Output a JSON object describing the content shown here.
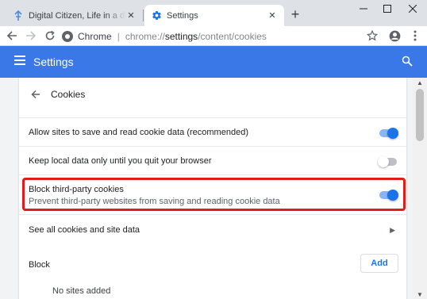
{
  "tabs": [
    {
      "title": "Digital Citizen, Life in a digital world",
      "favicon": "digital-citizen-icon",
      "active": false
    },
    {
      "title": "Settings",
      "favicon": "gear-icon",
      "active": true
    }
  ],
  "omnibox": {
    "chip": "Chrome",
    "separator": "|",
    "scheme": "chrome://",
    "host": "settings",
    "path": "/content/cookies"
  },
  "header": {
    "title": "Settings"
  },
  "subpage": {
    "title": "Cookies"
  },
  "settings": [
    {
      "id": "allow-sites",
      "label": "Allow sites to save and read cookie data (recommended)",
      "enabled": true
    },
    {
      "id": "keep-local",
      "label": "Keep local data only until you quit your browser",
      "enabled": false
    },
    {
      "id": "block-third-party",
      "label": "Block third-party cookies",
      "sublabel": "Prevent third-party websites from saving and reading cookie data",
      "enabled": true
    }
  ],
  "see_all": {
    "label": "See all cookies and site data"
  },
  "block": {
    "title": "Block",
    "add_label": "Add",
    "empty_text": "No sites added"
  },
  "colors": {
    "header": "#3b78e7",
    "toggle_on": "#1a73e8",
    "highlight": "#e21b1b"
  }
}
